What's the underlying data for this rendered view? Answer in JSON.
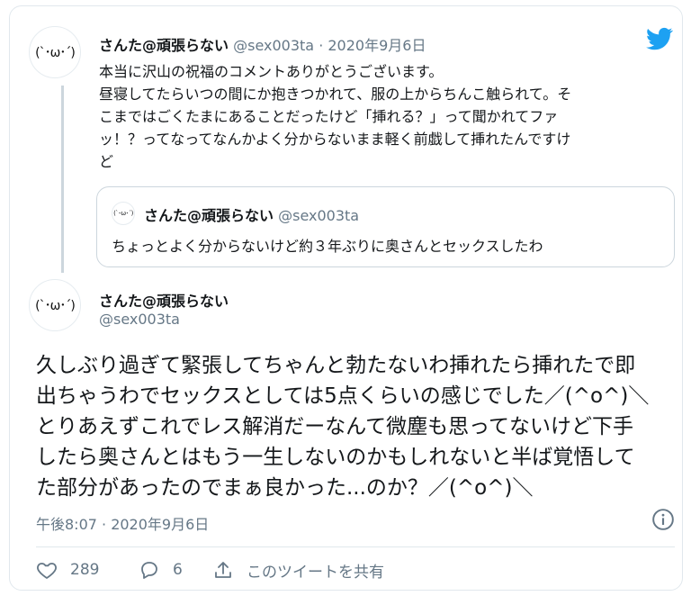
{
  "reply_tweet": {
    "avatar_text": "(`･ω･´)",
    "name": "さんた@頑張らない",
    "handle": "@sex003ta",
    "separator": "·",
    "date": "2020年9月6日",
    "lines": [
      "本当に沢山の祝福のコメントありがとうございます。",
      "昼寝してたらいつの間にか抱きつかれて、服の上からちんこ触られて。そ",
      "こまではごくたまにあることだったけど「挿れる？」って聞かれてファ",
      "ッ！？ってなってなんかよく分からないまま軽く前戯して挿れたんですけ",
      "ど"
    ]
  },
  "quoted_tweet": {
    "avatar_text": "(`･ω･´)",
    "name": "さんた@頑張らない",
    "handle": "@sex003ta",
    "text": "ちょっとよく分からないけど約３年ぶりに奥さんとセックスしたわ"
  },
  "main_tweet": {
    "avatar_text": "(`･ω･´)",
    "name": "さんた@頑張らない",
    "handle": "@sex003ta",
    "lines": [
      "久しぶり過ぎて緊張してちゃんと勃たないわ挿れたら挿れたで即",
      "出ちゃうわでセックスとしては5点くらいの感じでした／(^o^)＼",
      "とりあえずこれでレス解消だーなんて微塵も思ってないけど下手",
      "したら奥さんとはもう一生しないのかもしれないと半ば覚悟して",
      "た部分があったのでまぁ良かった...のか？／(^o^)＼"
    ],
    "timestamp": "午後8:07 · 2020年9月6日"
  },
  "actions": {
    "like_count": "289",
    "reply_count": "6",
    "share_label": "このツイートを共有"
  },
  "icons": {
    "brand": "twitter-bird-icon",
    "info": "info-icon",
    "like": "heart-icon",
    "reply": "speech-bubble-icon",
    "share": "share-icon"
  },
  "colors": {
    "twitter_blue": "#1da1f2",
    "muted": "#657786",
    "border": "#e1e8ed"
  }
}
